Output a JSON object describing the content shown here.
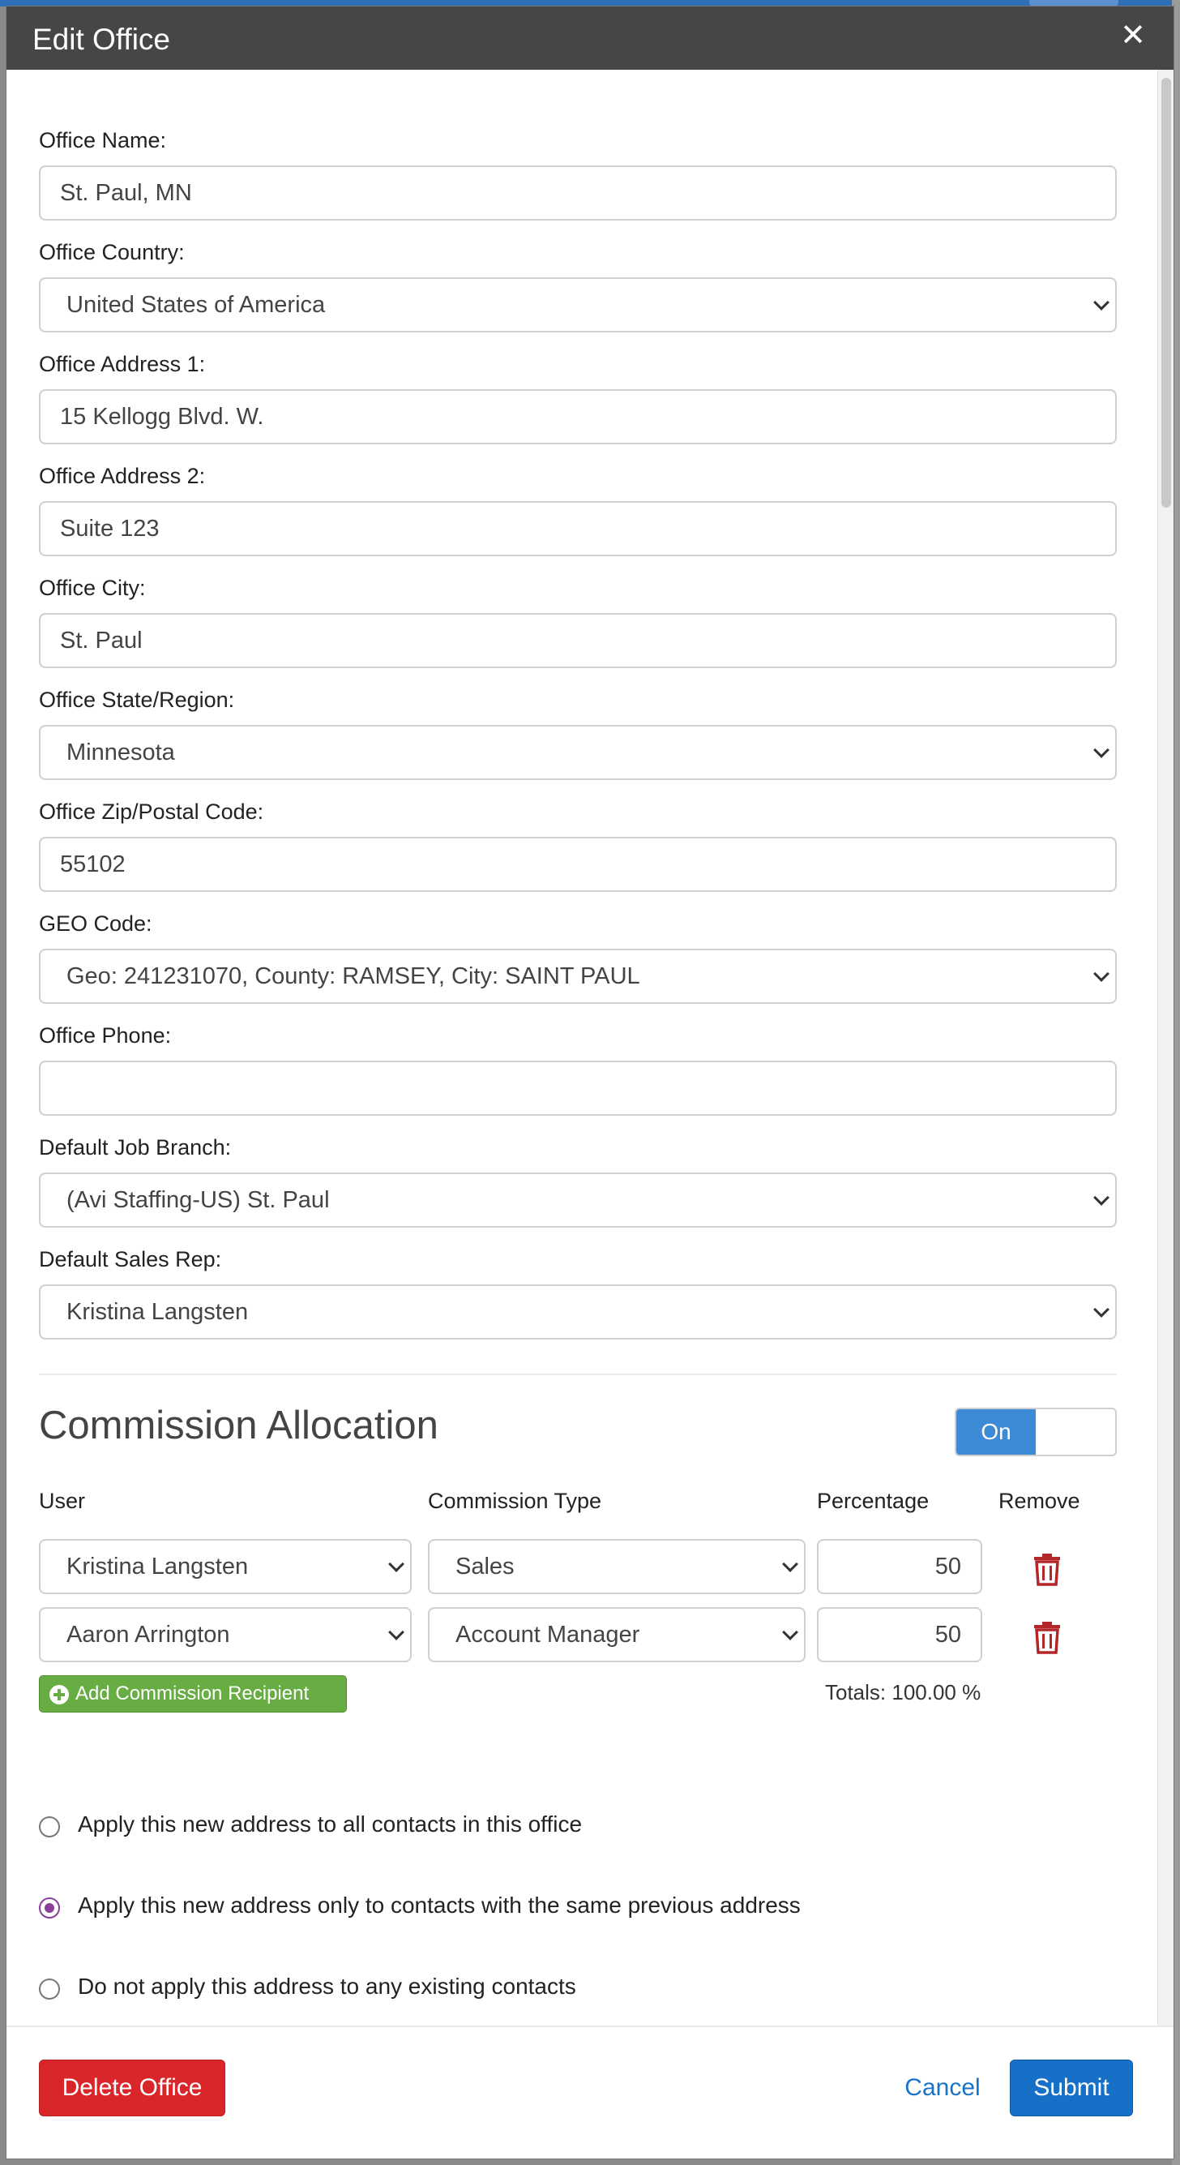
{
  "modal": {
    "title": "Edit Office",
    "close_glyph": "✕"
  },
  "fields": {
    "office_name": {
      "label": "Office Name:",
      "value": "St. Paul, MN"
    },
    "office_country": {
      "label": "Office Country:",
      "value": "United States of America"
    },
    "office_address1": {
      "label": "Office Address 1:",
      "value": "15 Kellogg Blvd. W."
    },
    "office_address2": {
      "label": "Office Address 2:",
      "value": "Suite 123"
    },
    "office_city": {
      "label": "Office City:",
      "value": "St. Paul"
    },
    "office_state": {
      "label": "Office State/Region:",
      "value": "Minnesota"
    },
    "office_zip": {
      "label": "Office Zip/Postal Code:",
      "value": "55102"
    },
    "geo_code": {
      "label": "GEO Code:",
      "value": "Geo: 241231070, County: RAMSEY, City: SAINT PAUL"
    },
    "office_phone": {
      "label": "Office Phone:",
      "value": ""
    },
    "default_job_branch": {
      "label": "Default Job Branch:",
      "value": "(Avi Staffing-US) St. Paul"
    },
    "default_sales_rep": {
      "label": "Default Sales Rep:",
      "value": "Kristina Langsten"
    }
  },
  "commission": {
    "title": "Commission Allocation",
    "toggle_label": "On",
    "toggle_on": true,
    "columns": {
      "user": "User",
      "type": "Commission Type",
      "percentage": "Percentage",
      "remove": "Remove"
    },
    "rows": [
      {
        "user": "Kristina Langsten",
        "type": "Sales",
        "percentage": "50"
      },
      {
        "user": "Aaron Arrington",
        "type": "Account Manager",
        "percentage": "50"
      }
    ],
    "add_label": "Add Commission Recipient",
    "totals": "Totals: 100.00 %"
  },
  "address_options": [
    {
      "label": "Apply this new address to all contacts in this office",
      "checked": false
    },
    {
      "label": "Apply this new address only to contacts with the same previous address",
      "checked": true
    },
    {
      "label": "Do not apply this address to any existing contacts",
      "checked": false
    }
  ],
  "footer": {
    "delete_label": "Delete Office",
    "cancel_label": "Cancel",
    "submit_label": "Submit"
  },
  "colors": {
    "header_bg": "#464646",
    "toggle_on": "#3d8ad6",
    "add_button": "#67ad44",
    "delete_button": "#d9262b",
    "submit_button": "#1670c8",
    "radio_checked": "#8a3f9a",
    "trash_icon": "#b3262a"
  }
}
